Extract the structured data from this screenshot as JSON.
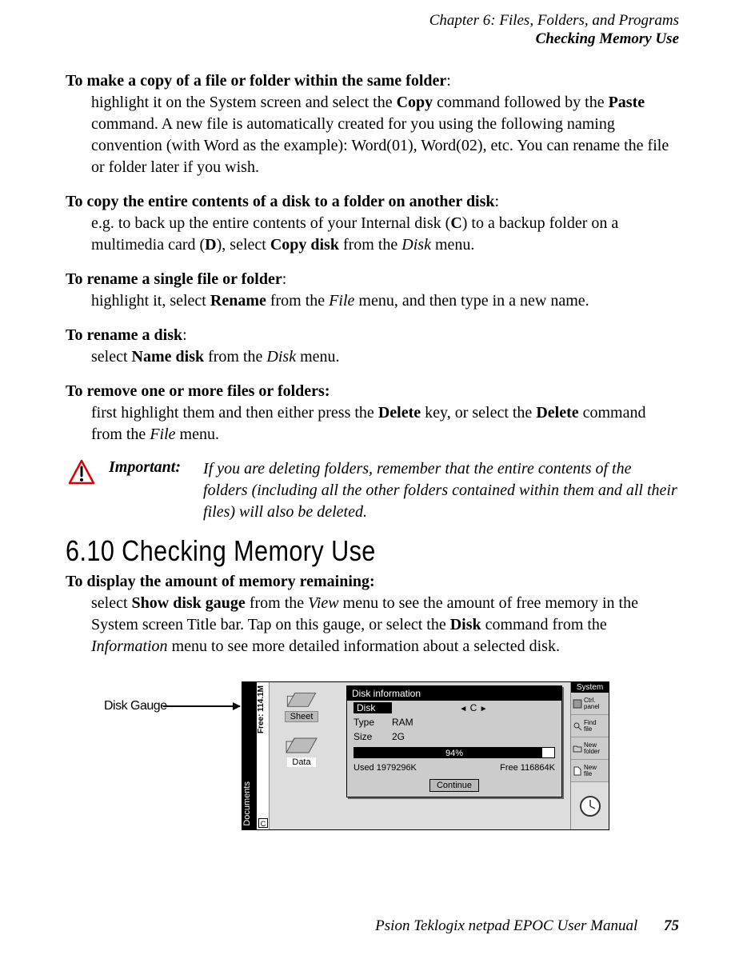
{
  "header": {
    "chapter": "Chapter 6:  Files, Folders, and Programs",
    "section": "Checking Memory Use"
  },
  "para1": {
    "lead": "To make a copy of a file or folder within the same folder",
    "t1": "highlight it on the System screen and select the ",
    "cmd1": "Copy",
    "t2": " command followed by the ",
    "cmd2": "Paste",
    "t3": " command. A new file is automatically created for you using the following naming convention (with Word as the example): Word(01), Word(02), etc. You can rename the file or folder later if you wish."
  },
  "para2": {
    "lead": "To copy the entire contents of a disk to a folder on another disk",
    "t1": "e.g. to back up the entire contents of your Internal disk (",
    "d1": "C",
    "t2": ") to a backup folder on a multimedia card (",
    "d2": "D",
    "t3": "), select ",
    "cmd": "Copy disk",
    "t4": " from the ",
    "menu": "Disk",
    "t5": " menu."
  },
  "para3": {
    "lead": "To rename a single file or folder",
    "t1": "highlight it, select ",
    "cmd": "Rename",
    "t2": " from the ",
    "menu": "File",
    "t3": " menu, and then type in a new name."
  },
  "para4": {
    "lead": "To rename a disk",
    "t1": "select ",
    "cmd": "Name disk",
    "t2": " from the ",
    "menu": "Disk",
    "t3": " menu."
  },
  "para5": {
    "lead": "To remove one or more files or folders:",
    "t1": "first highlight them and then either press the ",
    "k1": "Delete",
    "t2": " key, or select the ",
    "k2": "Delete",
    "t3": " command from the ",
    "menu": "File",
    "t4": " menu."
  },
  "important": {
    "label": "Important:",
    "text": "If you are deleting folders, remember that the entire contents of the folders (including all the other folders contained within them and all their files) will also be deleted."
  },
  "section_head": "6.10  Checking Memory Use",
  "para6": {
    "lead": "To display the amount of memory remaining:",
    "t1": "select ",
    "cmd": "Show disk gauge",
    "t2": " from the ",
    "m1": "View",
    "t3": " menu to see the amount of free memory in the System screen Title bar. Tap on this gauge, or select the ",
    "cmd2": "Disk",
    "t4": " command from the ",
    "m2": "Information",
    "t5": " menu to see more detailed information about a selected disk."
  },
  "fig": {
    "label": "Disk Gauge",
    "vbar_docs": "Documents",
    "gauge_text": "Free: 114.1M",
    "drive_letter": "C",
    "sheet_label": "Sheet",
    "data_label": "Data",
    "dialog": {
      "title": "Disk information",
      "disk_k": "Disk",
      "disk_v": "C",
      "type_k": "Type",
      "type_v": "RAM",
      "size_k": "Size",
      "size_v": "2G",
      "pct": "94%",
      "used": "Used 1979296K",
      "free": "Free 116864K",
      "btn": "Continue"
    },
    "right": {
      "header": "System",
      "b1": "Ctrl.\npanel",
      "b2": "Find\nfile",
      "b3": "New\nfolder",
      "b4": "New\nfile"
    }
  },
  "footer": {
    "title": "Psion Teklogix netpad EPOC User Manual",
    "page": "75"
  }
}
